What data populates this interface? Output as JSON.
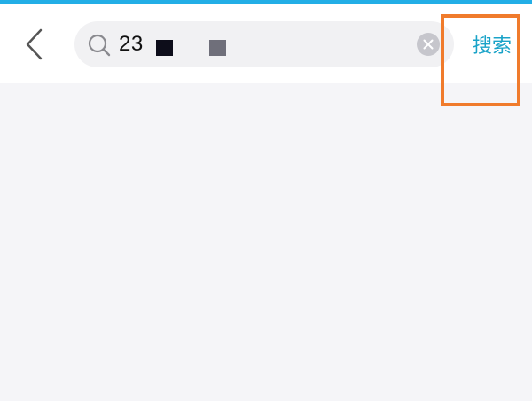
{
  "header": {
    "back_icon": "chevron-left-icon",
    "search": {
      "icon": "search-icon",
      "value": "23",
      "clear_icon": "close-icon"
    },
    "action_label": "搜索"
  },
  "colors": {
    "accent_bar": "#22aee6",
    "action_text": "#1aa3c8",
    "highlight_border": "#f07b2c",
    "page_background": "#f5f5f8"
  }
}
